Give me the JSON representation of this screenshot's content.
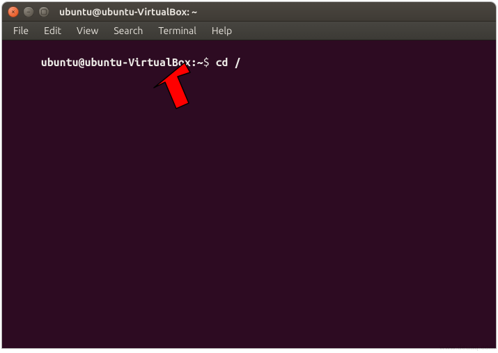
{
  "window": {
    "title": "ubuntu@ubuntu-VirtualBox: ~",
    "close_glyph": "×",
    "min_glyph": "−",
    "max_glyph": "▢"
  },
  "menubar": {
    "items": [
      {
        "label": "File",
        "hot": "F"
      },
      {
        "label": "Edit",
        "hot": "E"
      },
      {
        "label": "View",
        "hot": "V"
      },
      {
        "label": "Search",
        "hot": "S"
      },
      {
        "label": "Terminal",
        "hot": "T"
      },
      {
        "label": "Help",
        "hot": "H"
      }
    ]
  },
  "prompt": {
    "user_host": "ubuntu@ubuntu-VirtualBox",
    "separator": ":",
    "path": "~",
    "symbol": "$"
  },
  "command": "cd /",
  "colors": {
    "terminal_bg": "#2d0b22",
    "terminal_fg": "#eceae6",
    "titlebar_bg": "#3f3b35",
    "close_btn": "#e9602c"
  },
  "watermark": "www.deuaq.com"
}
